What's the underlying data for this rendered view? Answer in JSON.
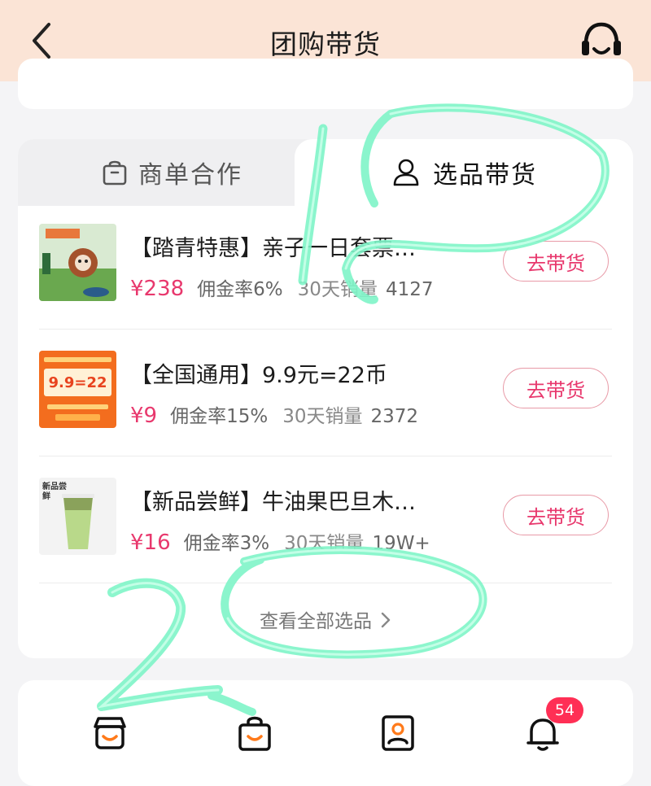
{
  "header": {
    "title": "团购带货"
  },
  "tabs": [
    {
      "label": "商单合作",
      "icon": "bag-icon"
    },
    {
      "label": "选品带货",
      "icon": "person-icon"
    }
  ],
  "products": [
    {
      "name": "【踏青特惠】亲子一日套票…",
      "price": "¥238",
      "commission": "佣金率6%",
      "sales_label": "30天销量",
      "sales": "4127",
      "button": "去带货",
      "thumb_text": ""
    },
    {
      "name": "【全国通用】9.9元=22币",
      "price": "¥9",
      "commission": "佣金率15%",
      "sales_label": "30天销量",
      "sales": "2372",
      "button": "去带货",
      "thumb_text": "9.9=22"
    },
    {
      "name": "【新品尝鲜】牛油果巴旦木…",
      "price": "¥16",
      "commission": "佣金率3%",
      "sales_label": "30天销量",
      "sales": "19W+",
      "button": "去带货",
      "thumb_text": "新品尝鲜"
    }
  ],
  "view_all": "查看全部选品",
  "bottom_nav": {
    "icons": [
      "shop-icon",
      "shopping-bag-icon",
      "profile-card-icon",
      "bell-icon"
    ],
    "badge": "54"
  },
  "annotations": {
    "mark1": "1",
    "mark2": "2"
  },
  "colors": {
    "header_bg": "#fbe4d6",
    "accent": "#e8386d",
    "badge": "#ff2f55",
    "highlight": "#7ff5c8"
  }
}
